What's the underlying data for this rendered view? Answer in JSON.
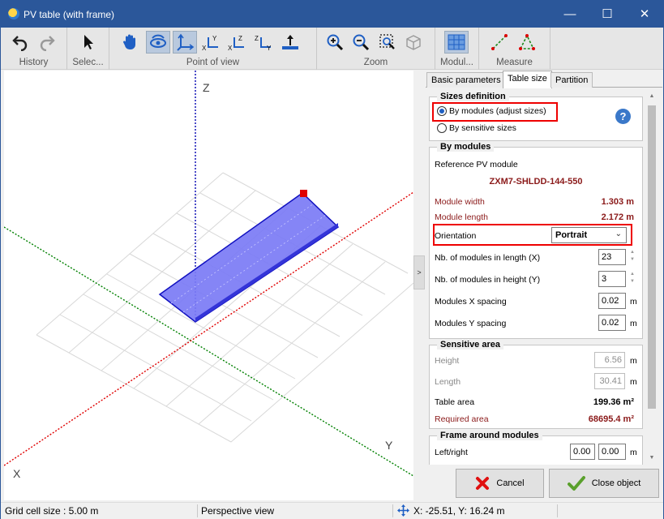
{
  "window": {
    "title": "PV table (with frame)",
    "minimize_label": "—",
    "maximize_label": "☐",
    "close_label": "✕"
  },
  "toolbar": {
    "groups": [
      {
        "label": "History"
      },
      {
        "label": "Selec..."
      },
      {
        "label": "Point of view"
      },
      {
        "label": "Zoom"
      },
      {
        "label": "Modul..."
      },
      {
        "label": "Measure"
      }
    ]
  },
  "viewport": {
    "axis_labels": {
      "z": "Z",
      "x": "X",
      "y": "Y"
    },
    "colors": {
      "x_axis": "#e00000",
      "y_axis": "#008000",
      "z_axis": "#0000b0",
      "table_fill": "#7b7bf5",
      "table_edge": "#1010c0",
      "handle": "#e00000",
      "grid": "#d8d8d8"
    },
    "collapse_label": ">"
  },
  "tabs": [
    {
      "label": "Basic parameters",
      "active": false
    },
    {
      "label": "Table size",
      "active": true
    },
    {
      "label": "Partition",
      "active": false
    }
  ],
  "sizes_definition": {
    "title": "Sizes definition",
    "by_modules_label": "By modules  (adjust sizes)",
    "by_sensitive_label": "By sensitive sizes",
    "selected": "by_modules",
    "help_label": "?"
  },
  "by_modules": {
    "title": "By modules",
    "reference_label": "Reference PV module",
    "reference_value": "ZXM7-SHLDD-144-550",
    "module_width_label": "Module width",
    "module_width_value": "1.303 m",
    "module_length_label": "Module length",
    "module_length_value": "2.172 m",
    "orientation_label": "Orientation",
    "orientation_value": "Portrait",
    "nb_length_label": "Nb. of modules in length (X)",
    "nb_length_value": "23",
    "nb_height_label": "Nb. of modules in height (Y)",
    "nb_height_value": "3",
    "x_spacing_label": "Modules X spacing",
    "x_spacing_value": "0.02",
    "y_spacing_label": "Modules Y spacing",
    "y_spacing_value": "0.02",
    "unit_m": "m"
  },
  "sensitive_area": {
    "title": "Sensitive area",
    "height_label": "Height",
    "height_value": "6.56",
    "length_label": "Length",
    "length_value": "30.41",
    "table_area_label": "Table area",
    "table_area_value": "199.36 m²",
    "required_area_label": "Required area",
    "required_area_value": "68695.4 m²",
    "unit_m": "m"
  },
  "frame": {
    "title": "Frame around modules",
    "left_right_label": "Left/right",
    "left_value": "0.00",
    "right_value": "0.00",
    "unit_m": "m"
  },
  "buttons": {
    "cancel_label": "Cancel",
    "close_object_label": "Close object"
  },
  "status": {
    "grid_cell_size": "Grid cell size :  5.00 m",
    "view_mode": "Perspective view",
    "coordinates": "X: -25.51, Y: 16.24 m"
  }
}
